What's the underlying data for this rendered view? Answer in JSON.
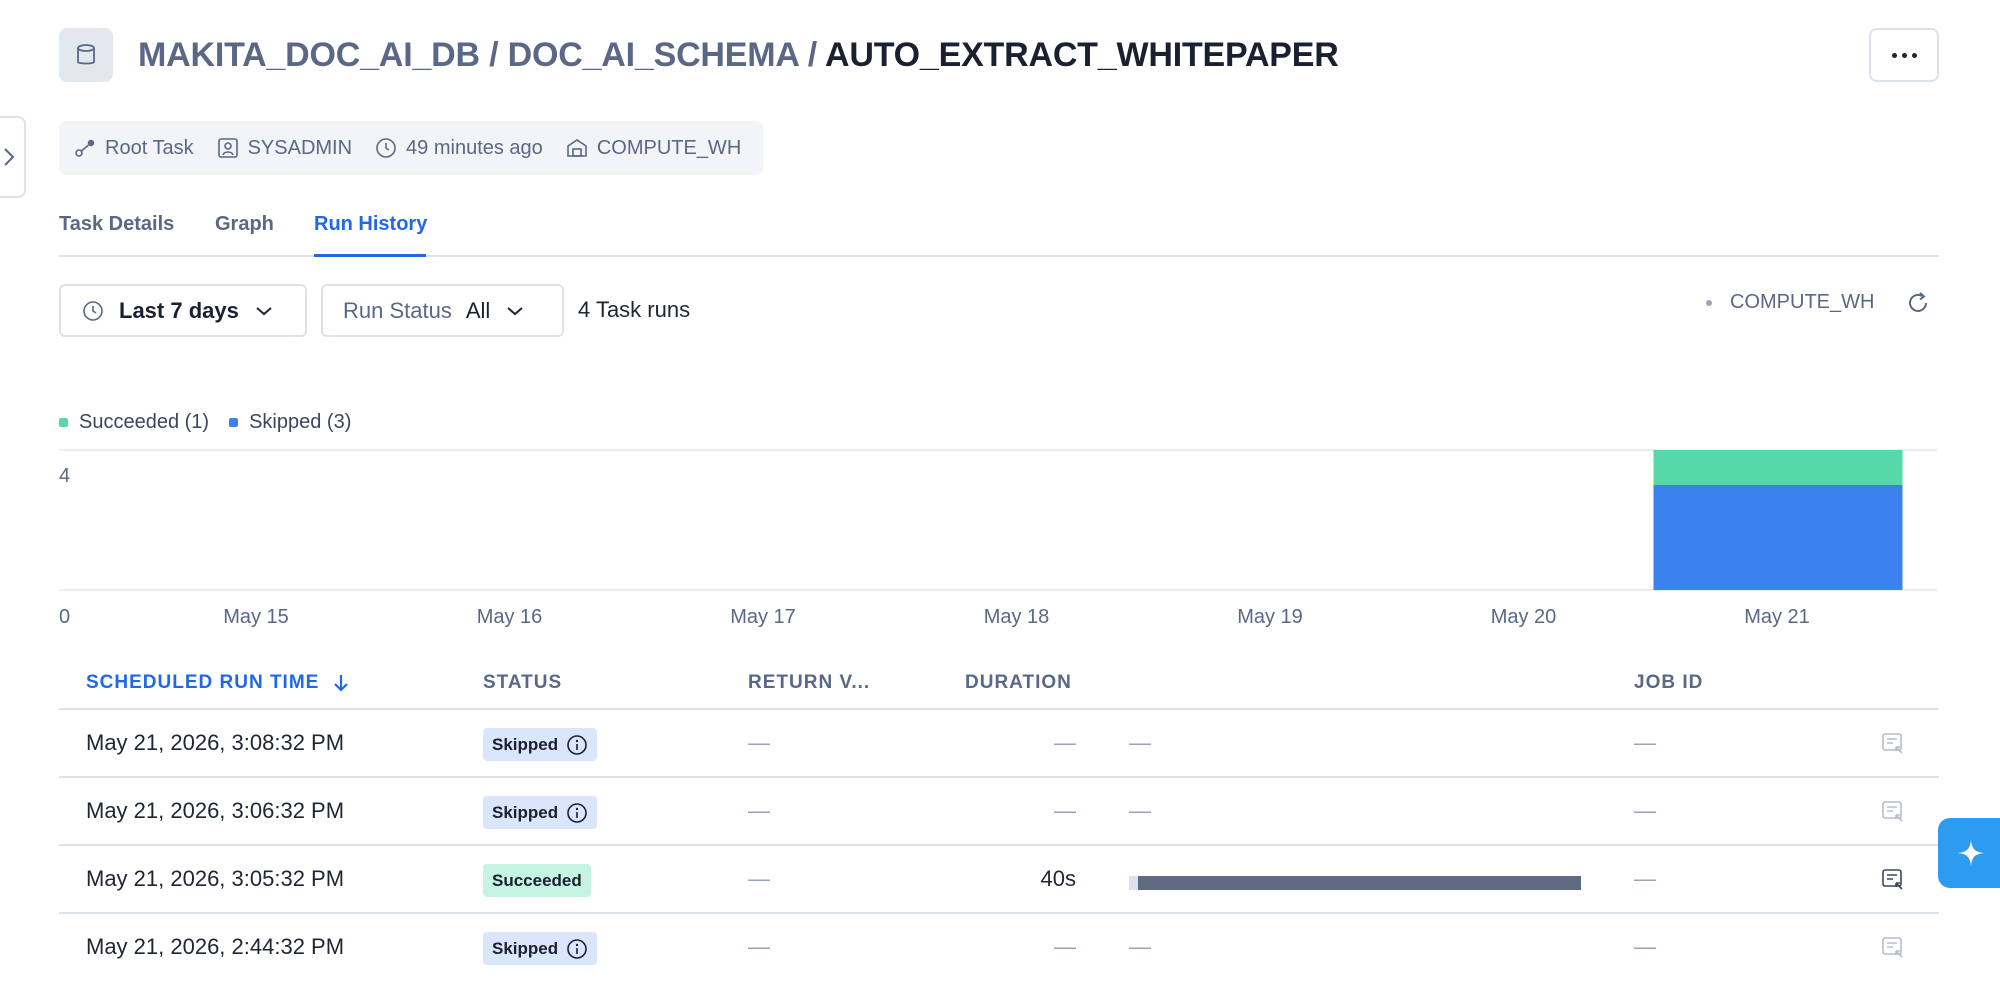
{
  "header": {
    "crumb_db": "MAKITA_DOC_AI_DB",
    "separator": "/",
    "crumb_schema": "DOC_AI_SCHEMA",
    "task_name": "AUTO_EXTRACT_WHITEPAPER"
  },
  "meta": {
    "task_type": "Root Task",
    "owner": "SYSADMIN",
    "last_modified": "49 minutes ago",
    "warehouse": "COMPUTE_WH"
  },
  "tabs": [
    "Task Details",
    "Graph",
    "Run History"
  ],
  "active_tab": "Run History",
  "filters": {
    "date_range": "Last 7 days",
    "run_status_label": "Run Status",
    "run_status_value": "All",
    "run_count": "4 Task runs"
  },
  "warehouse_indicator": "COMPUTE_WH",
  "legend": {
    "succeeded": "Succeeded (1)",
    "skipped": "Skipped (3)"
  },
  "colors": {
    "succeeded": "#57d8ab",
    "skipped": "#3b82ee",
    "accent": "#2168e8"
  },
  "chart_data": {
    "type": "bar",
    "stacked": true,
    "categories": [
      "May 15",
      "May 16",
      "May 17",
      "May 18",
      "May 19",
      "May 20",
      "May 21"
    ],
    "series": [
      {
        "name": "Skipped",
        "values": [
          0,
          0,
          0,
          0,
          0,
          0,
          3
        ]
      },
      {
        "name": "Succeeded",
        "values": [
          0,
          0,
          0,
          0,
          0,
          0,
          1
        ]
      }
    ],
    "y_ticks": [
      "0",
      "4"
    ],
    "ylim": [
      0,
      4
    ]
  },
  "table": {
    "columns": {
      "scheduled_run_time": "SCHEDULED RUN TIME",
      "status": "STATUS",
      "return_value": "RETURN V...",
      "duration": "DURATION",
      "job_id": "JOB ID"
    },
    "dash": "—",
    "rows": [
      {
        "time": "May 21, 2026, 3:08:32 PM",
        "status": "Skipped",
        "return_value": "—",
        "duration": "—",
        "job_id": "—"
      },
      {
        "time": "May 21, 2026, 3:06:32 PM",
        "status": "Skipped",
        "return_value": "—",
        "duration": "—",
        "job_id": "—"
      },
      {
        "time": "May 21, 2026, 3:05:32 PM",
        "status": "Succeeded",
        "return_value": "—",
        "duration": "40s",
        "job_id": "—"
      },
      {
        "time": "May 21, 2026, 2:44:32 PM",
        "status": "Skipped",
        "return_value": "—",
        "duration": "—",
        "job_id": "—"
      }
    ]
  }
}
